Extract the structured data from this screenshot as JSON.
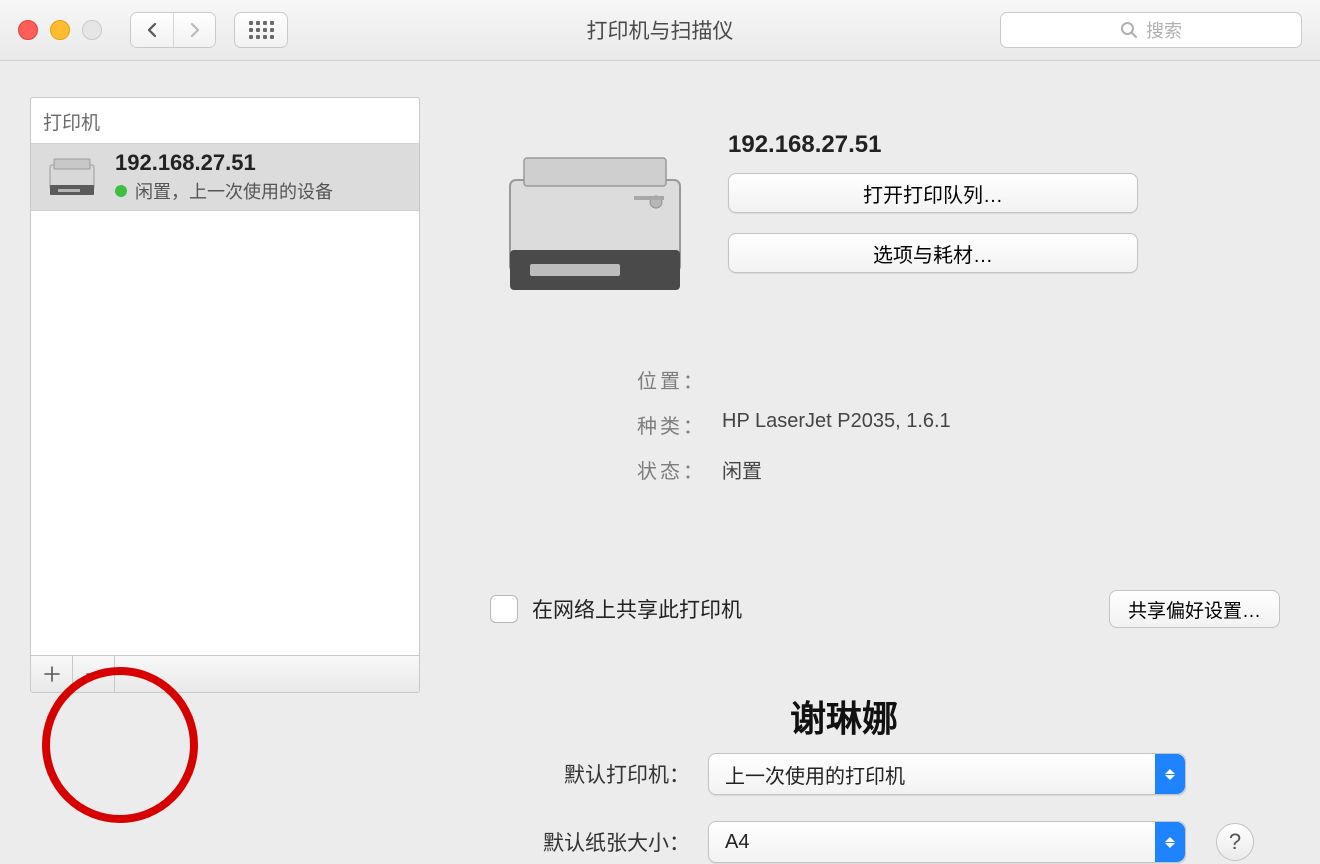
{
  "window": {
    "title": "打印机与扫描仪"
  },
  "search": {
    "placeholder": "搜索"
  },
  "sidebar": {
    "header": "打印机",
    "items": [
      {
        "name": "192.168.27.51",
        "status": "闲置，上一次使用的设备"
      }
    ]
  },
  "detail": {
    "title": "192.168.27.51",
    "open_queue_label": "打开打印队列…",
    "options_supplies_label": "选项与耗材…",
    "info": {
      "location_label": "位置：",
      "location_value": "",
      "kind_label": "种类：",
      "kind_value": "HP LaserJet P2035, 1.6.1",
      "status_label": "状态：",
      "status_value": "闲置"
    },
    "share": {
      "label": "在网络上共享此打印机",
      "prefs_button": "共享偏好设置…"
    }
  },
  "bottom": {
    "default_printer_label": "默认打印机：",
    "default_printer_value": "上一次使用的打印机",
    "default_paper_label": "默认纸张大小：",
    "default_paper_value": "A4"
  },
  "watermark": "谢琳娜"
}
